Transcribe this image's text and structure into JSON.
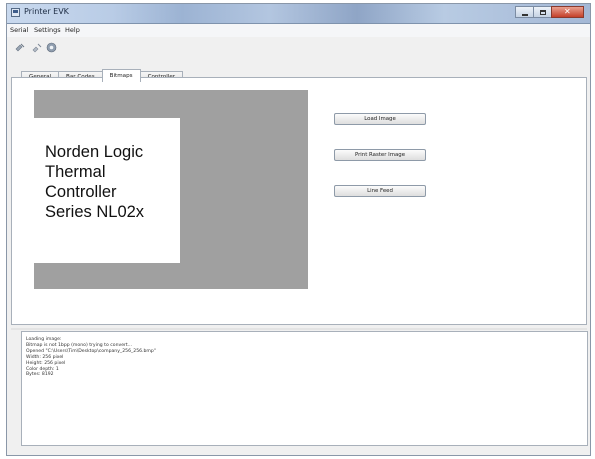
{
  "window": {
    "title": "Printer EVK"
  },
  "menu": [
    "Serial",
    "Settings",
    "Help"
  ],
  "toolbar": {
    "icons": [
      "connect-icon",
      "disconnect-icon",
      "settings-icon"
    ]
  },
  "tabs": [
    {
      "label": "General",
      "active": false
    },
    {
      "label": "Bar Codes",
      "active": false
    },
    {
      "label": "Bitmaps",
      "active": true
    },
    {
      "label": "Controller",
      "active": false
    }
  ],
  "bitmap_preview": {
    "lines": [
      "Norden Logic",
      "Thermal",
      "Controller",
      "Series NL02x"
    ]
  },
  "buttons": {
    "load_image": "Load Image",
    "print_raster": "Print Raster Image",
    "line_feed": "Line Feed"
  },
  "log": [
    "Loading image:",
    "Bitmap is not 1bpp (mono) trying to convert...",
    "Opened \"C:\\Users\\Tim\\Desktop\\company_256_256.bmp\"",
    "Width: 256 pixel",
    "Height: 256 pixel",
    "Color depth: 1",
    "Bytes: 8192"
  ],
  "colors": {
    "canvas_bg": "#a0a0a0",
    "titlebar": "#b3c6e0",
    "close_button": "#c4402a"
  }
}
